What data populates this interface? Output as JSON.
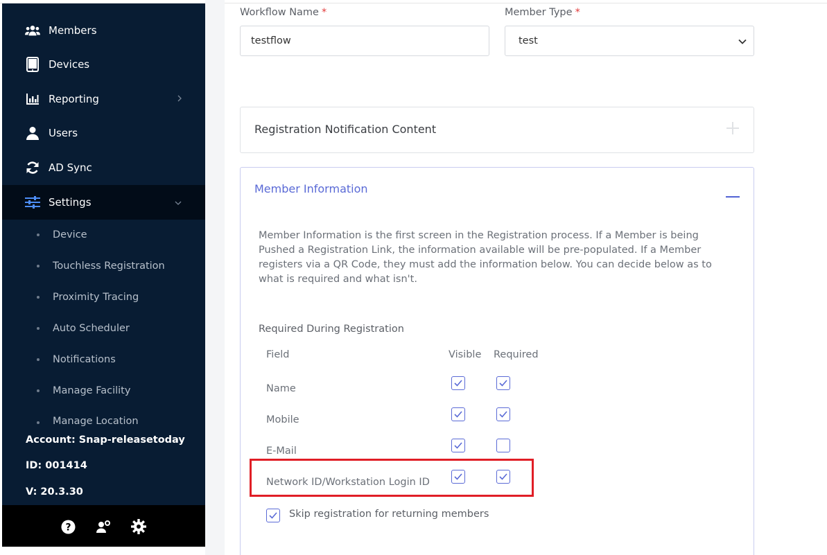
{
  "sidebar": {
    "nav": [
      {
        "label": "Members",
        "icon": "members-icon"
      },
      {
        "label": "Devices",
        "icon": "tablet-icon"
      },
      {
        "label": "Reporting",
        "icon": "bar-chart-icon"
      },
      {
        "label": "Users",
        "icon": "user-icon"
      },
      {
        "label": "AD Sync",
        "icon": "sync-icon"
      },
      {
        "label": "Settings",
        "icon": "sliders-icon"
      }
    ],
    "settings_sub": [
      {
        "label": "Device"
      },
      {
        "label": "Touchless Registration"
      },
      {
        "label": "Proximity Tracing"
      },
      {
        "label": "Auto Scheduler"
      },
      {
        "label": "Notifications"
      },
      {
        "label": "Manage Facility"
      },
      {
        "label": "Manage Location"
      }
    ],
    "account": "Account: Snap-releasetoday",
    "id": "ID: 001414",
    "version": "V: 20.3.30"
  },
  "form": {
    "workflow_name_label": "Workflow Name",
    "workflow_name_value": "testflow",
    "member_type_label": "Member Type",
    "member_type_value": "test",
    "required_mark": "*"
  },
  "panels": {
    "notification": {
      "title": "Registration Notification Content",
      "toggle": "+"
    },
    "member_info": {
      "title": "Member Information",
      "description": "Member Information is the first screen in the Registration process. If a Member is being Pushed a Registration Link, the information available will be pre-populated. If a Member registers via a QR Code, they must add the information below. You can decide below as to what is required and what isn't.",
      "section_title": "Required During Registration",
      "columns": {
        "field": "Field",
        "visible": "Visible",
        "required": "Required"
      },
      "rows": [
        {
          "label": "Name",
          "visible": true,
          "required": true
        },
        {
          "label": "Mobile",
          "visible": true,
          "required": true
        },
        {
          "label": "E-Mail",
          "visible": true,
          "required": false
        },
        {
          "label": "Network ID/Workstation Login ID",
          "visible": true,
          "required": true
        }
      ],
      "skip_label": "Skip registration for returning members",
      "skip_checked": true
    }
  },
  "colors": {
    "sidebar": "#081c33",
    "accent": "#5a6ad6",
    "highlight": "#e01e26"
  }
}
